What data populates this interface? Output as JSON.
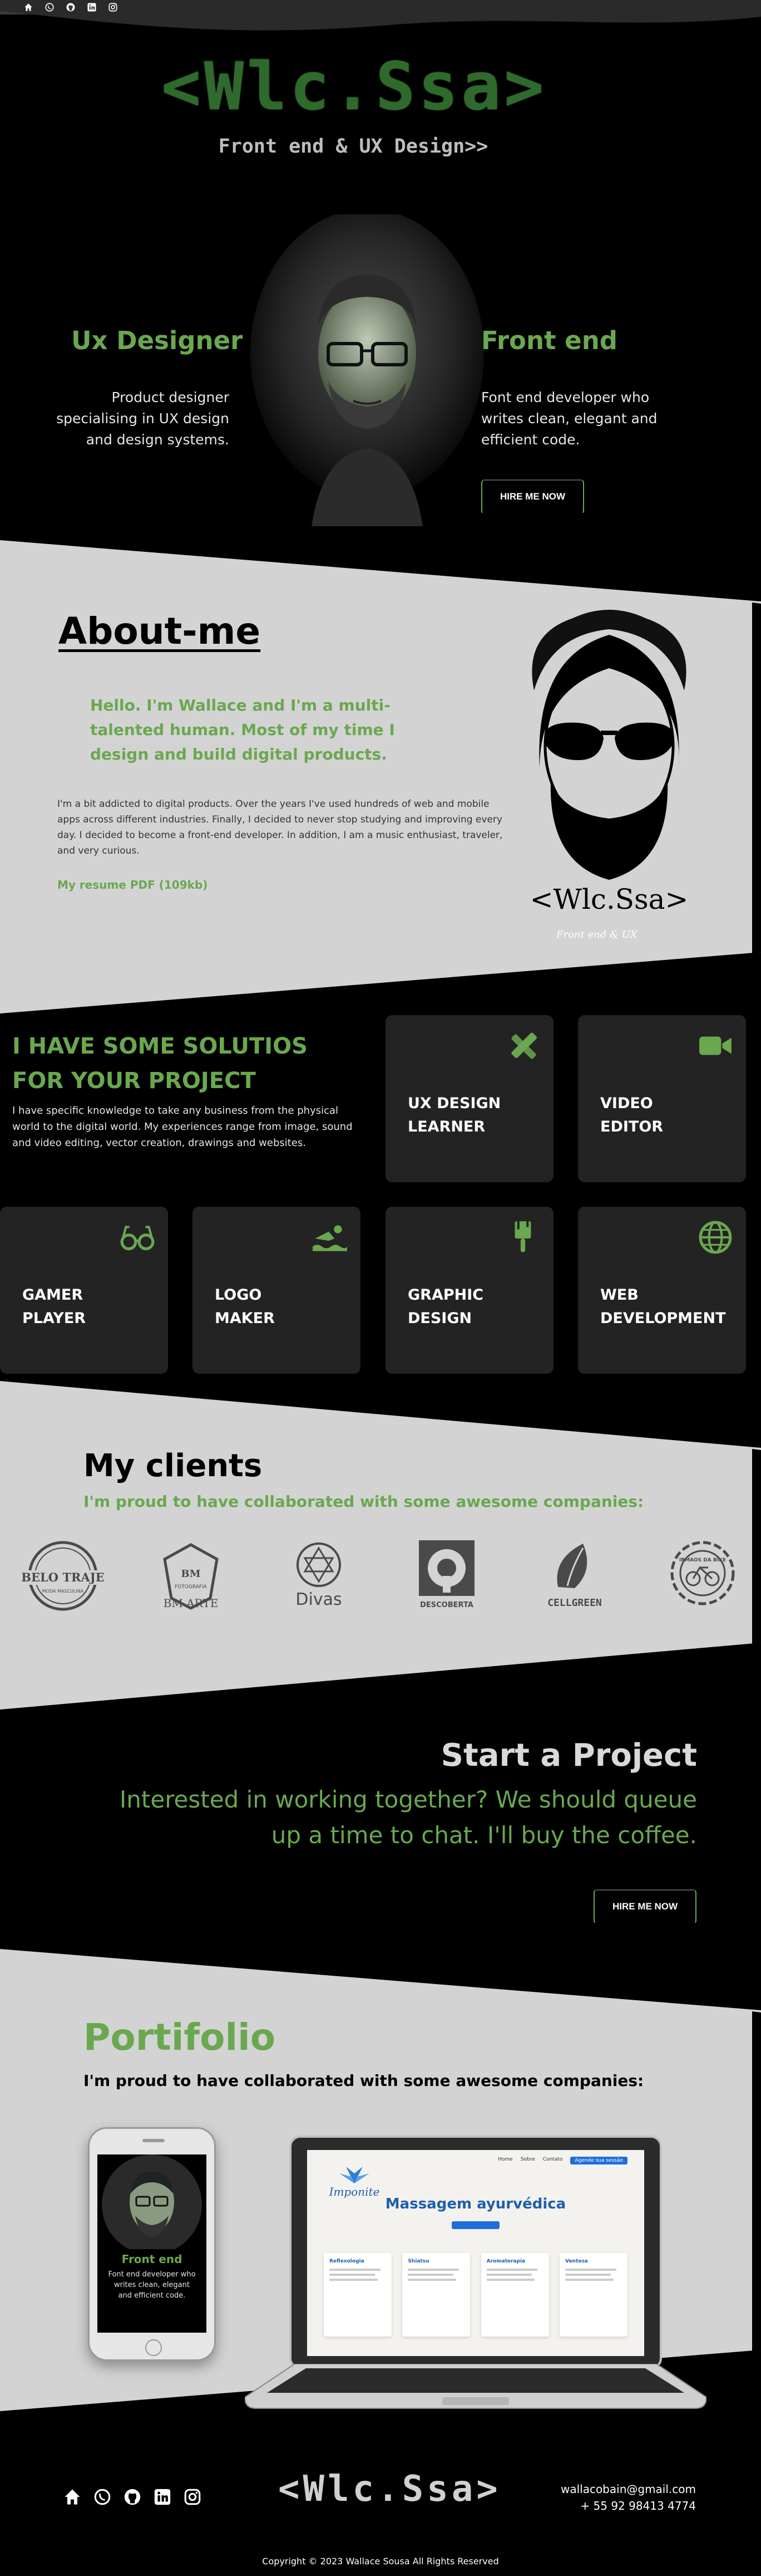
{
  "social": {
    "icons": [
      "home-icon",
      "whatsapp-icon",
      "github-icon",
      "linkedin-icon",
      "instagram-icon"
    ]
  },
  "hero": {
    "logo": "<Wlc.Ssa>",
    "subtitle": "Front end & UX Design>>",
    "left_title": "Ux Designer",
    "left_text": "Product designer specialising in UX design and design systems.",
    "right_title": "Front end",
    "right_text": "Font end developer who writes clean, elegant and efficient code.",
    "cta": "HIRE ME NOW"
  },
  "about": {
    "title": "About-me",
    "lead": "Hello. I'm Wallace and I'm a multi-talented human. Most of my time I design and build digital products.",
    "text": "I'm a bit addicted to digital products. Over the years I've used hundreds of web and mobile apps across different industries. Finally, I decided to never stop studying and improving every day. I decided to become a front-end developer. In addition, I am a music enthusiast, traveler, and very curious.",
    "resume": "My resume PDF (109kb)",
    "signature": "<Wlc.Ssa>",
    "signature_sub": "Front end & UX"
  },
  "services": {
    "title": "I HAVE SOME SOLUTIOS FOR YOUR PROJECT",
    "text": "I have specific knowledge to take any business from the physical world to the digital world. My experiences range from image, sound and video editing, vector creation, drawings and websites.",
    "cards": [
      {
        "label": "UX DESIGN\nLEARNER",
        "icon": "design-tools-icon"
      },
      {
        "label": "VIDEO\nEDITOR",
        "icon": "video-camera-icon"
      },
      {
        "label": "GAMER\nPLAYER",
        "icon": "glasses-icon"
      },
      {
        "label": "LOGO\nMAKER",
        "icon": "swimmer-icon"
      },
      {
        "label": "GRAPHIC\nDESIGN",
        "icon": "paint-brush-icon"
      },
      {
        "label": "WEB\nDEVELOPMENT",
        "icon": "globe-icon"
      }
    ]
  },
  "clients": {
    "title": "My clients",
    "subtitle": "I'm proud to have collaborated with some awesome companies:",
    "logos": [
      {
        "name": "BELO TRAJE",
        "sub": "MODA MASCULINA"
      },
      {
        "name": "BM ARTE",
        "sub": "FOTOGRAFIA"
      },
      {
        "name": "Divas",
        "sub": ""
      },
      {
        "name": "DESCOBERTA",
        "sub": ""
      },
      {
        "name": "CELLGREEN",
        "sub": ""
      },
      {
        "name": "IRMAOS DA BIKE",
        "sub": ""
      }
    ]
  },
  "start": {
    "title": "Start a Project",
    "text": "Interested in working together? We should queue up a time to chat. I'll buy the coffee.",
    "cta": "HIRE ME NOW"
  },
  "portfolio": {
    "title": "Portifolio",
    "subtitle": "I'm proud to have collaborated with some awesome companies:",
    "phone_title": "Front end",
    "phone_text": "Font end developer who writes clean, elegant and efficient code.",
    "laptop_brand": "Imponite",
    "laptop_heading": "Massagem ayurvédica",
    "laptop_nav": [
      "Home",
      "Sobre",
      "Contato",
      "Agende sua sessão"
    ],
    "laptop_cards": [
      "Reflexologia",
      "Shiatsu",
      "Aromaterapia",
      "Ventosa"
    ]
  },
  "footer": {
    "logo": "<Wlc.Ssa>",
    "email": "wallacobain@gmail.com",
    "phone": "+ 55 92 98413 4774",
    "copyright": "Copyright © 2023 Wallace Sousa All Rights Reserved"
  },
  "colors": {
    "accent": "#6aa84f",
    "light_band": "#d3d3d3",
    "card": "#232323"
  }
}
